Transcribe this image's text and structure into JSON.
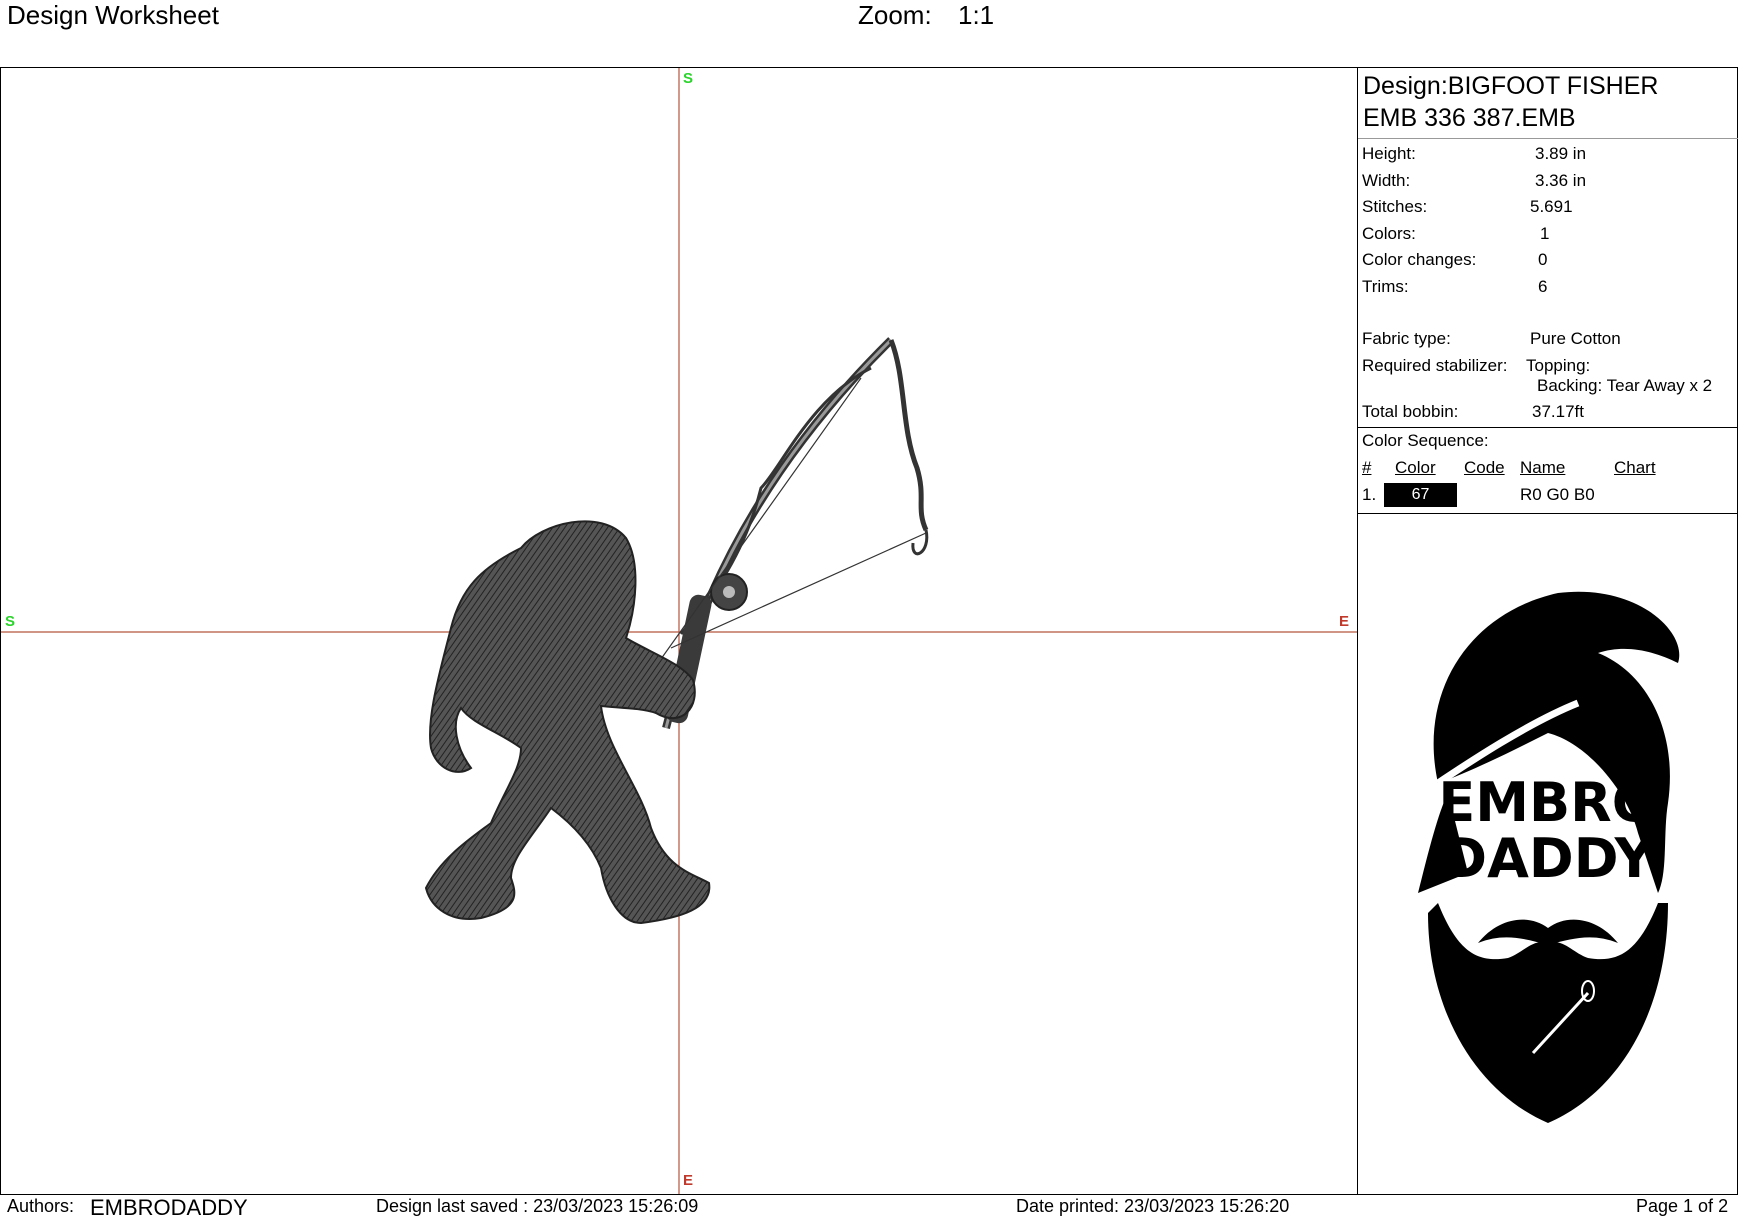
{
  "header": {
    "title": "Design Worksheet",
    "zoom_label": "Zoom:",
    "zoom_value": "1:1"
  },
  "canvas": {
    "markers": {
      "top": "S",
      "left": "S",
      "right": "E",
      "bottom": "E"
    },
    "colors": {
      "axis": "#b5563c",
      "start": "#2bd42b",
      "end": "#c0392b",
      "stitch": "#3a3a3a"
    },
    "icons": {
      "design": "bigfoot-fishing-icon"
    }
  },
  "panel": {
    "design_line1": "Design:BIGFOOT FISHER",
    "design_line2": "EMB 336 387.EMB",
    "stats": [
      {
        "label": "Height:",
        "value": "3.89 in"
      },
      {
        "label": "Width:",
        "value": "3.36 in"
      },
      {
        "label": "Stitches:",
        "value": "5.691"
      },
      {
        "label": "Colors:",
        "value": "1"
      },
      {
        "label": "Color changes:",
        "value": "0"
      },
      {
        "label": "Trims:",
        "value": "6"
      }
    ],
    "fabric_label": "Fabric type:",
    "fabric_value": "Pure Cotton",
    "stabilizer_label": "Required stabilizer:",
    "topping": "Topping:",
    "backing": "Backing: Tear Away x 2",
    "bobbin_label": "Total bobbin:",
    "bobbin_value": "37.17ft",
    "sequence_title": "Color Sequence:",
    "sequence_headers": {
      "num": "#",
      "color": "Color",
      "code": "Code",
      "name": "Name",
      "chart": "Chart"
    },
    "sequence": [
      {
        "num": "1.",
        "color": "67",
        "code": "",
        "name": "R0 G0 B0",
        "chart": ""
      }
    ],
    "logo": {
      "line1": "EMBRO",
      "line2": "DADDY",
      "icon": "bearded-man-logo-icon"
    }
  },
  "footer": {
    "authors_label": "Authors:",
    "authors_value": "EMBRODADDY",
    "saved": "Design last saved : 23/03/2023 15:26:09",
    "printed": "Date printed: 23/03/2023 15:26:20",
    "page": "Page 1 of 2"
  }
}
